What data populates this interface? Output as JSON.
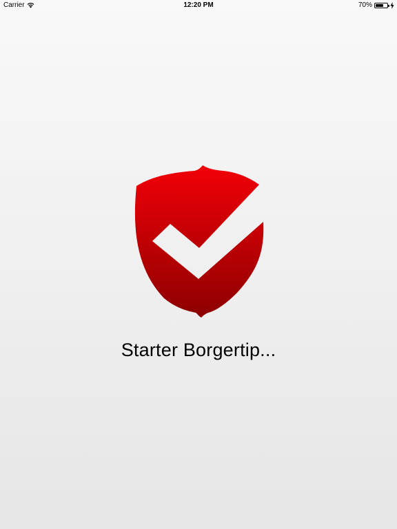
{
  "status_bar": {
    "carrier": "Carrier",
    "time": "12:20 PM",
    "battery_percent_text": "70%",
    "battery_level": 0.7,
    "wifi_icon": "wifi-icon",
    "charging_icon": "bolt-icon"
  },
  "splash": {
    "logo_icon": "shield-check-icon",
    "loading_text": "Starter Borgertip...",
    "colors": {
      "shield_top": "#f20008",
      "shield_bottom": "#8c0000",
      "background_top": "#f9f9f9",
      "background_bottom": "#e6e6e6"
    }
  }
}
